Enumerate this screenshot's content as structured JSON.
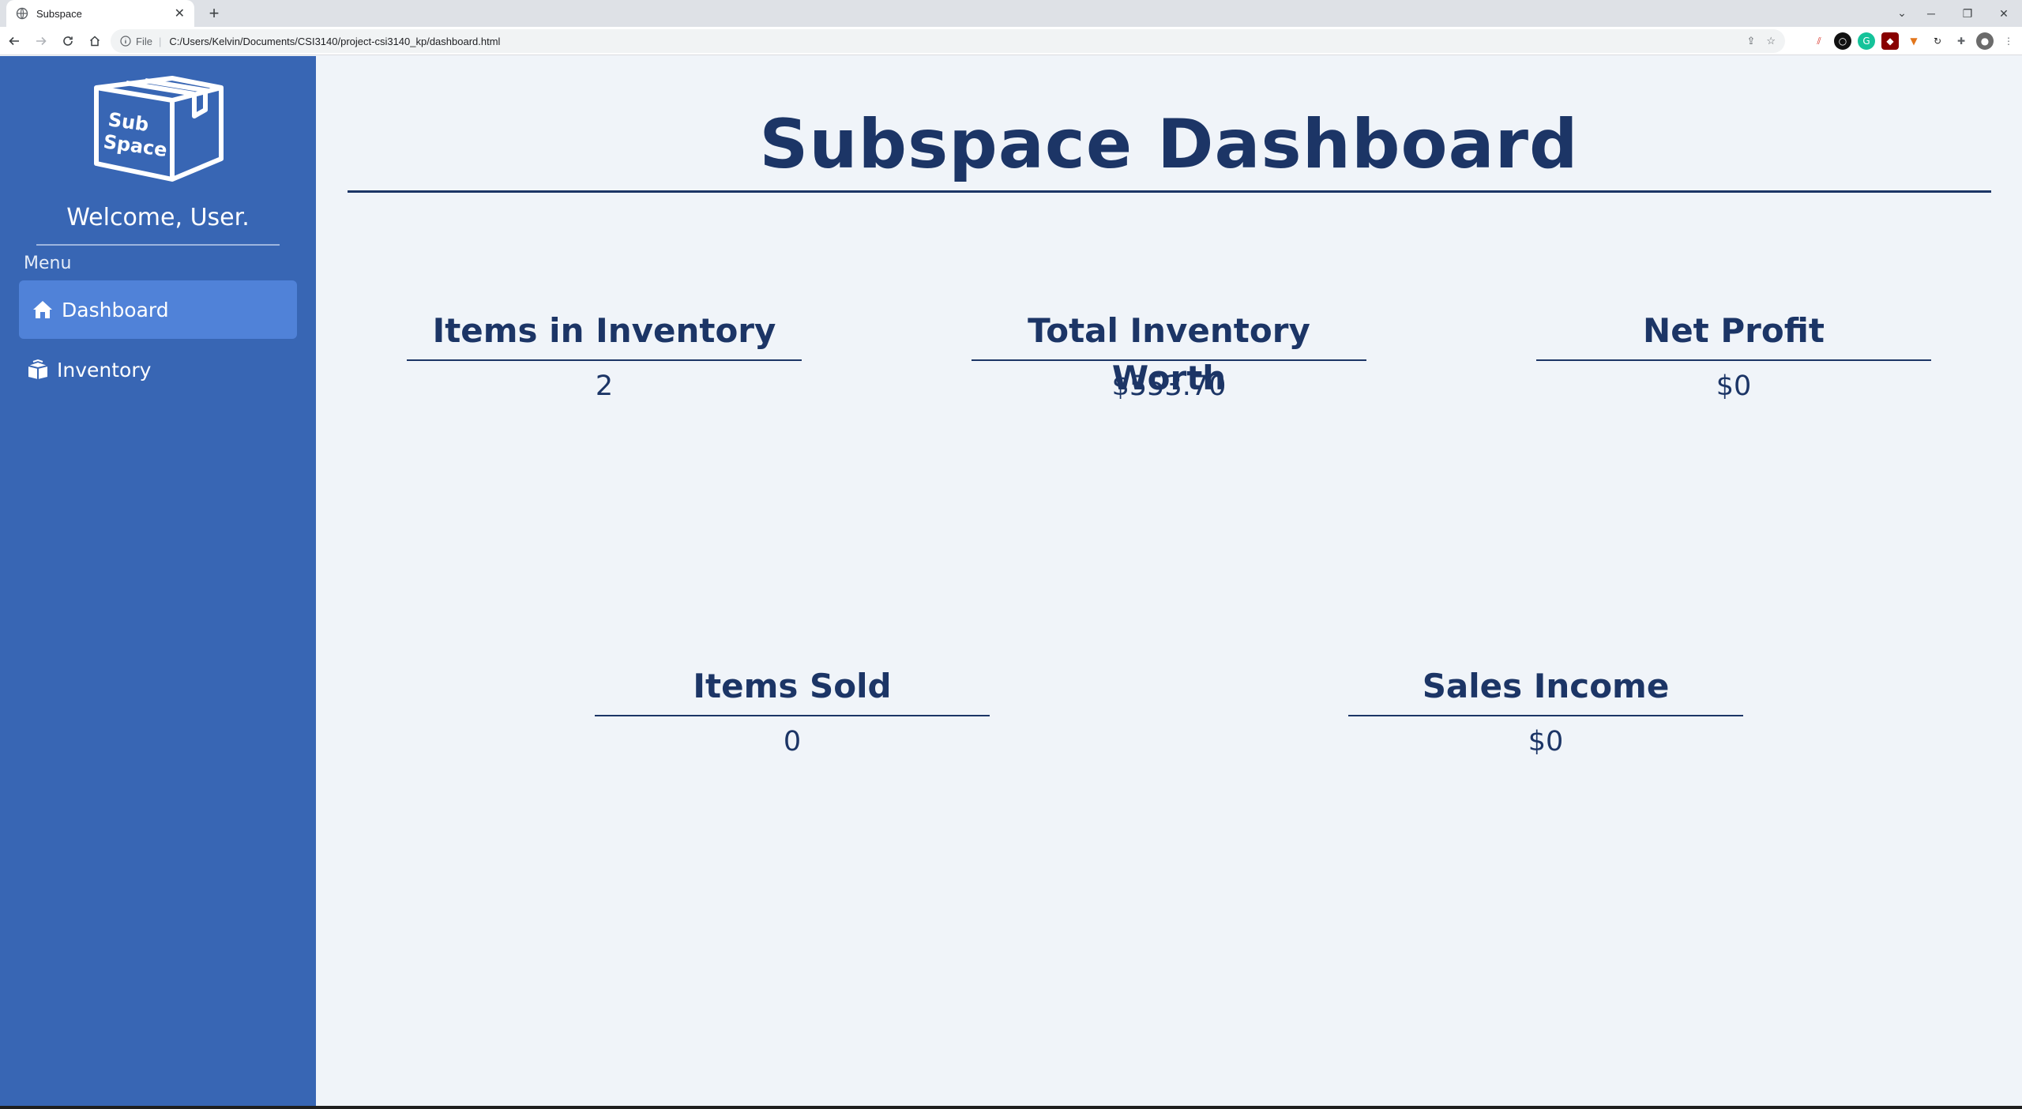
{
  "browser": {
    "tab_title": "Subspace",
    "tab_close": "✕",
    "new_tab": "+",
    "scheme": "File",
    "url": "C:/Users/Kelvin/Documents/CSI3140/project-csi3140_kp/dashboard.html",
    "window_minimize": "─",
    "window_restore": "❐",
    "window_close": "✕"
  },
  "sidebar": {
    "logo_text_line1": "Sub",
    "logo_text_line2": "Space",
    "welcome": "Welcome, User.",
    "menu_label": "Menu",
    "items": [
      {
        "label": "Dashboard",
        "icon": "home-icon",
        "active": true
      },
      {
        "label": "Inventory",
        "icon": "boxes-icon",
        "active": false
      }
    ]
  },
  "main": {
    "title": "Subspace Dashboard",
    "stats": [
      {
        "label": "Items in Inventory",
        "value": "2"
      },
      {
        "label": "Total Inventory Worth",
        "value": "$553.70"
      },
      {
        "label": "Net Profit",
        "value": "$0"
      },
      {
        "label": "Items Sold",
        "value": "0"
      },
      {
        "label": "Sales Income",
        "value": "$0"
      }
    ]
  },
  "colors": {
    "sidebar_bg": "#3866b4",
    "active_item_bg": "#5082d8",
    "text_dark": "#1c3566",
    "page_bg": "#f0f4f9"
  }
}
